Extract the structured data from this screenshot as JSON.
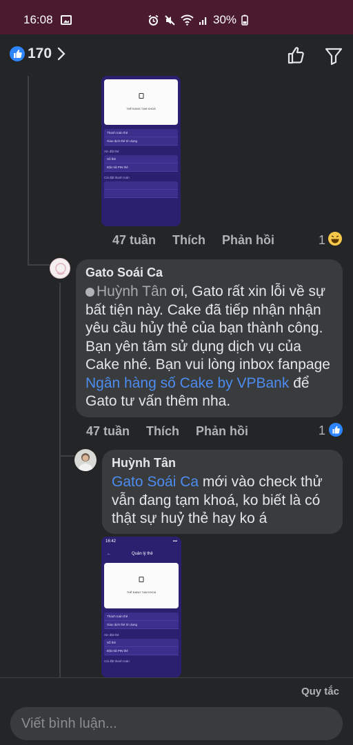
{
  "status_bar": {
    "time": "16:08",
    "battery": "30%"
  },
  "header": {
    "like_count": "170"
  },
  "thread": {
    "prev_image_meta": {
      "age": "47 tuần",
      "like": "Thích",
      "reply": "Phản hồi",
      "reaction_count": "1"
    },
    "comments": [
      {
        "author": "Gato Soái Ca",
        "mention": "Huỳnh Tân",
        "text_1": " ơi, Gato rất xin lỗi về sự bất tiện này. Cake đã tiếp nhận nhận yêu cầu hủy thẻ của bạn thành công. Bạn yên tâm sử dụng dịch vụ của Cake nhé. Bạn vui lòng inbox fanpage ",
        "link": "Ngân hàng số Cake by VPBank",
        "text_2": " để Gato tư vấn thêm nha.",
        "age": "47 tuần",
        "like": "Thích",
        "reply": "Phản hồi",
        "reaction_count": "1"
      },
      {
        "author": "Huỳnh Tân",
        "mention": "Gato Soái Ca",
        "text_1": " mới vào check thử vẫn đang tạm khoá, ko biết là có thật sự huỷ thẻ hay ko á"
      }
    ],
    "phone_shot": {
      "time": "16:42",
      "title": "Quản lý thẻ",
      "card_label": "THẺ ĐANG TẠM KHOÁ",
      "menu_1": "Thanh toán thẻ",
      "menu_2": "Giao dịch thẻ tín dụng",
      "section_1": "Xin đặt thẻ",
      "menu_3": "Số thẻ",
      "menu_4": "Đặt mã PIN thẻ",
      "section_2": "Cài đặt thanh toán"
    }
  },
  "footer": {
    "rules_label": "Quy tắc",
    "input_placeholder": "Viết bình luận..."
  },
  "colors": {
    "status_bar": "#4a1a2e",
    "background": "#242526",
    "bubble": "#3a3b3c",
    "link": "#4c8cf0",
    "like_blue": "#2d86ff"
  }
}
